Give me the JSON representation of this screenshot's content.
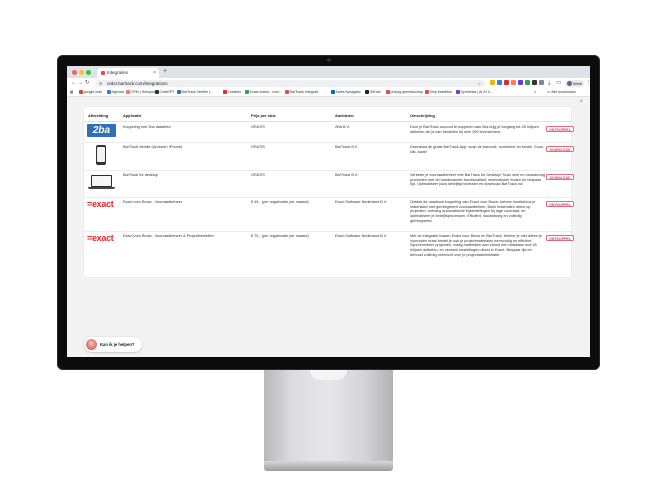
{
  "browser": {
    "tab_title": "Integraties",
    "tab_close": "×",
    "new_tab": "+",
    "url": "order.bartrack.com/integrations",
    "profile_name": "Werk",
    "bookmarks": [
      {
        "label": "google mail",
        "color": "#d9463b"
      },
      {
        "label": "Agenda",
        "color": "#3b78e7"
      },
      {
        "label": "CRM | Hubspot",
        "color": "#ff7a59"
      },
      {
        "label": "ChatGPT",
        "color": "#333333"
      },
      {
        "label": "BarTrack Verifier |...",
        "color": "#2f6fb8"
      },
      {
        "label": "Leadinfo",
        "color": "#e8262d"
      },
      {
        "label": "Exact tracks - over...",
        "color": "#3aa14b"
      },
      {
        "label": "BarTrack Integrati...",
        "color": "#e84a4a"
      },
      {
        "label": "Sales Navigator",
        "color": "#0a66c2"
      },
      {
        "label": "GitHub",
        "color": "#222222"
      },
      {
        "label": "pricing gereedschap",
        "color": "#e84a4a"
      },
      {
        "label": "Ship bestellen",
        "color": "#e84a4a"
      },
      {
        "label": "Synthesia | AI AI V...",
        "color": "#5b3ee4"
      }
    ],
    "bookmarks_all": "Alle bookmarks"
  },
  "table": {
    "headers": {
      "image": "Afbeelding",
      "application": "Applicatie",
      "price": "Prijs per stuk",
      "supplier": "Aanbieder",
      "description": "Omschrijving"
    },
    "rows": [
      {
        "logo": "2ba",
        "application": "Koppeling met 2ba datafeed",
        "price": "GRATIS",
        "supplier": "2BA B.V.",
        "description": "Door je BarTrack account te koppelen aan 2ba krijg je toegang tot 28 miljoen artikelen die je kan bestellen bij ruim 390 leveranciers.",
        "button": "ONTKOPPEL"
      },
      {
        "logo": "phone",
        "application": "BarTrack Mobile (Android / iPhone)",
        "price": "GRATIS",
        "supplier": "BarTrack B.V.",
        "description": "Download de gratis BarTrack App: scan de barcode, controleer en bestel. Scan, klik, klaar!",
        "button": "DOWNLOAD"
      },
      {
        "logo": "laptop",
        "application": "BarTrack for desktop",
        "price": "GRATIS",
        "supplier": "BarTrack B.V.",
        "description": "Verbeter je voorraadbeheer met BarTrack for Desktop! Scan snel en nauwkeurig producten met de handscanner-functionaliteit, minimaliseer fouten en bespaar tijd. Optimaliseer jouw bedrijfsprocessen en download BarTrack nu!",
        "button": "DOWNLOAD"
      },
      {
        "logo": "exact",
        "application": "Exact voor Bouw - Voorraadbeheer",
        "price": "€ 49,- (per organisatie per maand)",
        "supplier": "Exact Software Nederland B.V.",
        "description": "Ontdek de naadloze koppeling van Exact voor Bouw: beheer moeiteloos je materialen met geïntegreerd voorraadbeheer. Boek materialen direct op projecten, ontvang automatische bijbestellingen bij lage voorraad, en optimaliseer je bedrijfsprocessen. Efficiënt, nauwkeurig en volledig geïntegreerd.",
        "button": "ONTKOPPEL"
      },
      {
        "logo": "exact",
        "application": "Exact voor Bouw - Voorraadbeheer & Projectbestellen",
        "price": "€ 75,- (per organisatie per maand)",
        "supplier": "Exact Software Nederland B.V.",
        "description": "Met de integratie tussen Exact voor Bouw en BarTrack, beheer je niet alleen je voorraden maar bestel je ook je projectmaterialen eenvoudig en efficiënt. Synchroniseer projecten, vraag materialen aan vanuit een database met 28 miljoen artikelen, en verwerk bestellingen direct in Exact. Bespaar tijd en behoud volledig overzicht over je projectadministratie.",
        "button": "ONTKOPPEL"
      }
    ]
  },
  "logos": {
    "2ba": "2ba",
    "exact": "=exact"
  },
  "chat": {
    "label": "Kan ik je helpen?"
  },
  "colors": {
    "accent": "#e26a7d",
    "exact_red": "#e8262d",
    "brand_2ba": "#2f6fb8"
  }
}
